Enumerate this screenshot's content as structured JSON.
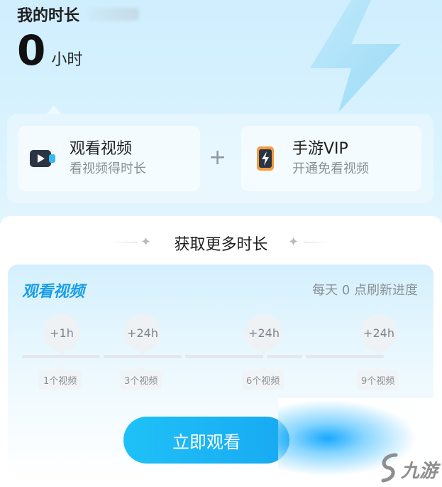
{
  "header": {
    "title": "我的时长",
    "hours_value": "0",
    "hours_unit": "小时"
  },
  "options": [
    {
      "title": "观看视频",
      "subtitle": "看视频得时长",
      "icon": "video-play-icon"
    },
    {
      "title": "手游VIP",
      "subtitle": "开通免看视频",
      "icon": "phone-bolt-icon"
    }
  ],
  "plus_sign": "+",
  "more": {
    "title": "获取更多时长"
  },
  "task": {
    "name": "观看视频",
    "refresh_note": "每天 0 点刷新进度",
    "milestones": [
      {
        "reward": "+1h",
        "requirement": "1个视频"
      },
      {
        "reward": "+24h",
        "requirement": "3个视频"
      },
      {
        "reward": "+24h",
        "requirement": "6个视频"
      },
      {
        "reward": "+24h",
        "requirement": "9个视频"
      }
    ],
    "button_label": "立即观看"
  },
  "watermark": {
    "text": "九游"
  },
  "colors": {
    "accent": "#1a9ee8",
    "button": "#18a9f2",
    "background": "#d6f1fe"
  }
}
